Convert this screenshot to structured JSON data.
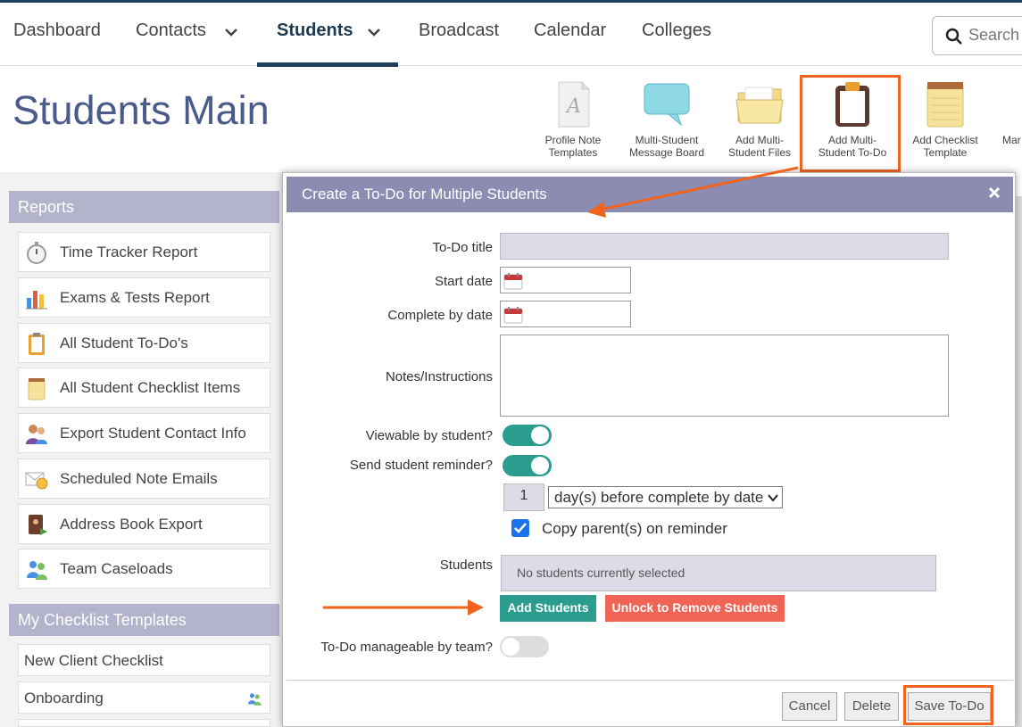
{
  "nav": {
    "items": [
      "Dashboard",
      "Contacts",
      "Students",
      "Broadcast",
      "Calendar",
      "Colleges"
    ],
    "active": "Students",
    "search_placeholder": "Search S"
  },
  "page": {
    "title": "Students Main"
  },
  "toolbar": [
    {
      "label_line1": "Profile Note",
      "label_line2": "Templates",
      "icon": "note-template-icon"
    },
    {
      "label_line1": "Multi-Student",
      "label_line2": "Message Board",
      "icon": "speech-bubble-icon"
    },
    {
      "label_line1": "Add Multi-",
      "label_line2": "Student Files",
      "icon": "folder-icon"
    },
    {
      "label_line1": "Add Multi-",
      "label_line2": "Student To-Do",
      "icon": "clipboard-icon"
    },
    {
      "label_line1": "Add Checklist",
      "label_line2": "Template",
      "icon": "notepad-icon"
    },
    {
      "label_line1": "Mar",
      "label_line2": "",
      "icon": "partial-icon"
    }
  ],
  "sidebar": {
    "reports_header": "Reports",
    "reports": [
      {
        "label": "Time Tracker Report",
        "icon": "stopwatch-icon"
      },
      {
        "label": "Exams & Tests Report",
        "icon": "bar-chart-icon"
      },
      {
        "label": "All Student To-Do's",
        "icon": "clipboard-icon"
      },
      {
        "label": "All Student Checklist Items",
        "icon": "notepad-icon"
      },
      {
        "label": "Export Student Contact Info",
        "icon": "people-icon"
      },
      {
        "label": "Scheduled Note Emails",
        "icon": "envelope-clock-icon"
      },
      {
        "label": "Address Book Export",
        "icon": "address-book-icon"
      },
      {
        "label": "Team Caseloads",
        "icon": "team-icon"
      }
    ],
    "templates_header": "My Checklist Templates",
    "templates": [
      {
        "label": "New Client Checklist"
      },
      {
        "label": "Onboarding"
      }
    ]
  },
  "modal": {
    "title": "Create a To-Do for Multiple Students",
    "fields": {
      "todo_title": {
        "label": "To-Do title",
        "value": ""
      },
      "start_date": {
        "label": "Start date",
        "value": ""
      },
      "complete_by": {
        "label": "Complete by date",
        "value": ""
      },
      "notes": {
        "label": "Notes/Instructions",
        "value": ""
      },
      "viewable": {
        "label": "Viewable by student?",
        "on": true
      },
      "reminder": {
        "label": "Send student reminder?",
        "on": true
      },
      "reminder_days": "1",
      "reminder_unit": "day(s) before complete by date",
      "copy_parents": {
        "label": "Copy parent(s) on reminder",
        "checked": true
      },
      "students": {
        "label": "Students",
        "placeholder": "No students currently selected"
      },
      "team_manage": {
        "label": "To-Do manageable by team?",
        "on": false
      }
    },
    "buttons": {
      "add_students": "Add Students",
      "unlock": "Unlock to Remove Students",
      "cancel": "Cancel",
      "delete": "Delete",
      "save": "Save To-Do"
    }
  },
  "colors": {
    "accent": "#f0641e",
    "teal": "#2a9d8f",
    "coral": "#f06455",
    "modal_header": "#8c8cb3",
    "nav_dark": "#1f3f5e"
  }
}
